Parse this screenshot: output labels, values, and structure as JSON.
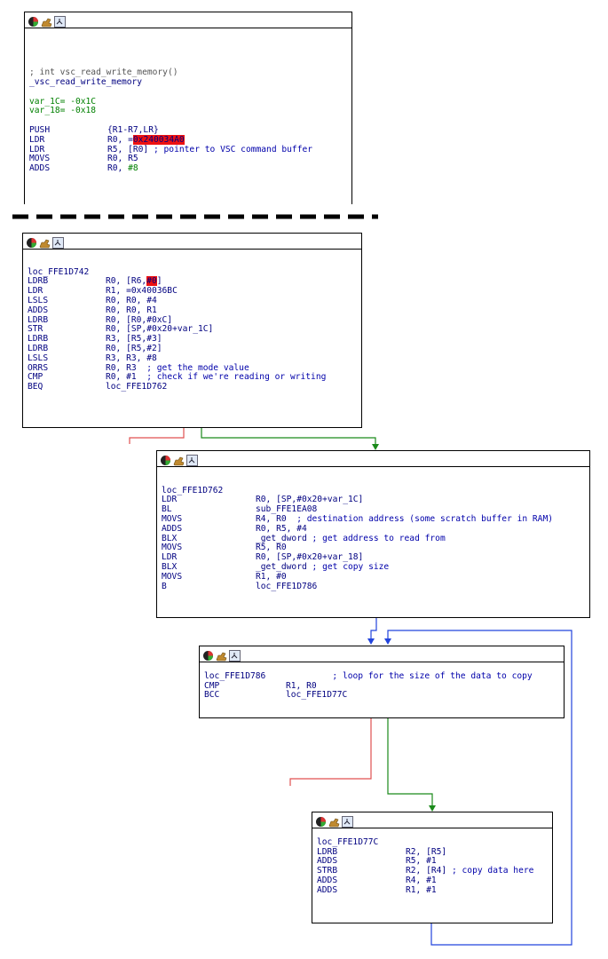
{
  "blocks": [
    {
      "id": "b1",
      "lines": [
        {
          "t": "blank"
        },
        {
          "t": "blank"
        },
        {
          "t": "blank"
        },
        {
          "t": "blank"
        },
        {
          "t": "comment",
          "text": "; int vsc_read_write_memory()"
        },
        {
          "t": "label",
          "text": "_vsc_read_write_memory"
        },
        {
          "t": "blank"
        },
        {
          "t": "var",
          "text": "var_1C= -0x1C"
        },
        {
          "t": "var",
          "text": "var_18= -0x18"
        },
        {
          "t": "blank"
        },
        {
          "t": "ins",
          "mn": "PUSH",
          "op": [
            [
              "t",
              "{R1-R7,LR}"
            ]
          ]
        },
        {
          "t": "ins",
          "mn": "LDR",
          "op": [
            [
              "t",
              "R0, ="
            ],
            [
              "h",
              "0x240034A0"
            ]
          ]
        },
        {
          "t": "ins",
          "mn": "LDR",
          "op": [
            [
              "t",
              "R5, [R0] "
            ],
            [
              "c",
              "; pointer to VSC command buffer"
            ]
          ]
        },
        {
          "t": "ins",
          "mn": "MOVS",
          "op": [
            [
              "t",
              "R0, R5"
            ]
          ]
        },
        {
          "t": "ins",
          "mn": "ADDS",
          "op": [
            [
              "t",
              "R0, "
            ],
            [
              "n",
              "#8"
            ]
          ]
        }
      ]
    },
    {
      "id": "b2",
      "lines": [
        {
          "t": "blank"
        },
        {
          "t": "blank"
        },
        {
          "t": "label",
          "text": "loc_FFE1D742"
        },
        {
          "t": "ins",
          "mn": "LDRB",
          "op": [
            [
              "t",
              "R0, [R6,"
            ],
            [
              "h",
              "#0"
            ],
            [
              "t",
              "]"
            ]
          ]
        },
        {
          "t": "ins",
          "mn": "LDR",
          "op": [
            [
              "t",
              "R1, =0x40036BC"
            ]
          ]
        },
        {
          "t": "ins",
          "mn": "LSLS",
          "op": [
            [
              "t",
              "R0, R0, #4"
            ]
          ]
        },
        {
          "t": "ins",
          "mn": "ADDS",
          "op": [
            [
              "t",
              "R0, R0, R1"
            ]
          ]
        },
        {
          "t": "ins",
          "mn": "LDRB",
          "op": [
            [
              "t",
              "R0, [R0,#0xC]"
            ]
          ]
        },
        {
          "t": "ins",
          "mn": "STR",
          "op": [
            [
              "t",
              "R0, [SP,#0x20+var_1C]"
            ]
          ]
        },
        {
          "t": "ins",
          "mn": "LDRB",
          "op": [
            [
              "t",
              "R3, [R5,#3]"
            ]
          ]
        },
        {
          "t": "ins",
          "mn": "LDRB",
          "op": [
            [
              "t",
              "R0, [R5,#2]"
            ]
          ]
        },
        {
          "t": "ins",
          "mn": "LSLS",
          "op": [
            [
              "t",
              "R3, R3, #8"
            ]
          ]
        },
        {
          "t": "ins",
          "mn": "ORRS",
          "op": [
            [
              "t",
              "R0, R3  "
            ],
            [
              "c",
              "; get the mode value"
            ]
          ]
        },
        {
          "t": "ins",
          "mn": "CMP",
          "op": [
            [
              "t",
              "R0, #1  "
            ],
            [
              "c",
              "; check if we're reading or writing"
            ]
          ]
        },
        {
          "t": "ins",
          "mn": "BEQ",
          "op": [
            [
              "t",
              "loc_FFE1D762"
            ]
          ]
        }
      ]
    },
    {
      "id": "b3",
      "lines": [
        {
          "t": "blank"
        },
        {
          "t": "blank"
        },
        {
          "t": "label",
          "text": "loc_FFE1D762"
        },
        {
          "t": "ins",
          "mn": "LDR",
          "op": [
            [
              "t",
              "R0, [SP,#0x20+var_1C]"
            ]
          ]
        },
        {
          "t": "ins",
          "mn": "BL",
          "op": [
            [
              "t",
              "sub_FFE1EA08"
            ]
          ]
        },
        {
          "t": "ins",
          "mn": "MOVS",
          "op": [
            [
              "t",
              "R4, R0  "
            ],
            [
              "c",
              "; destination address (some scratch buffer in RAM)"
            ]
          ]
        },
        {
          "t": "ins",
          "mn": "ADDS",
          "op": [
            [
              "t",
              "R0, R5, #4"
            ]
          ]
        },
        {
          "t": "ins",
          "mn": "BLX",
          "op": [
            [
              "t",
              "_get_dword "
            ],
            [
              "c",
              "; get address to read from"
            ]
          ]
        },
        {
          "t": "ins",
          "mn": "MOVS",
          "op": [
            [
              "t",
              "R5, R0"
            ]
          ]
        },
        {
          "t": "ins",
          "mn": "LDR",
          "op": [
            [
              "t",
              "R0, [SP,#0x20+var_18]"
            ]
          ]
        },
        {
          "t": "ins",
          "mn": "BLX",
          "op": [
            [
              "t",
              "_get_dword "
            ],
            [
              "c",
              "; get copy size"
            ]
          ]
        },
        {
          "t": "ins",
          "mn": "MOVS",
          "op": [
            [
              "t",
              "R1, #0"
            ]
          ]
        },
        {
          "t": "ins",
          "mn": "B",
          "op": [
            [
              "t",
              "loc_FFE1D786"
            ]
          ]
        }
      ]
    },
    {
      "id": "b4",
      "lines": [
        {
          "t": "blank"
        },
        {
          "t": "label",
          "text": "loc_FFE1D786             ",
          "extra": "; loop for the size of the data to copy"
        },
        {
          "t": "ins",
          "mn": "CMP",
          "op": [
            [
              "t",
              "R1, R0"
            ]
          ]
        },
        {
          "t": "ins",
          "mn": "BCC",
          "op": [
            [
              "t",
              "loc_FFE1D77C"
            ]
          ]
        }
      ]
    },
    {
      "id": "b5",
      "lines": [
        {
          "t": "blank"
        },
        {
          "t": "label",
          "text": "loc_FFE1D77C"
        },
        {
          "t": "ins",
          "mn": "LDRB",
          "op": [
            [
              "t",
              "R2, [R5]"
            ]
          ]
        },
        {
          "t": "ins",
          "mn": "ADDS",
          "op": [
            [
              "t",
              "R5, #1"
            ]
          ]
        },
        {
          "t": "ins",
          "mn": "STRB",
          "op": [
            [
              "t",
              "R2, [R4] "
            ],
            [
              "c",
              "; copy data here"
            ]
          ]
        },
        {
          "t": "ins",
          "mn": "ADDS",
          "op": [
            [
              "t",
              "R4, #1"
            ]
          ]
        },
        {
          "t": "ins",
          "mn": "ADDS",
          "op": [
            [
              "t",
              "R1, #1"
            ]
          ]
        }
      ]
    }
  ],
  "colors": {
    "edge_taken": "#1a8a1a",
    "edge_fallthrough": "#e05050",
    "edge_unconditional": "#2244dd",
    "highlight": "#ee1111"
  },
  "icons": [
    "graph-color-icon",
    "edit-hand-icon",
    "zoom-graph-icon"
  ]
}
